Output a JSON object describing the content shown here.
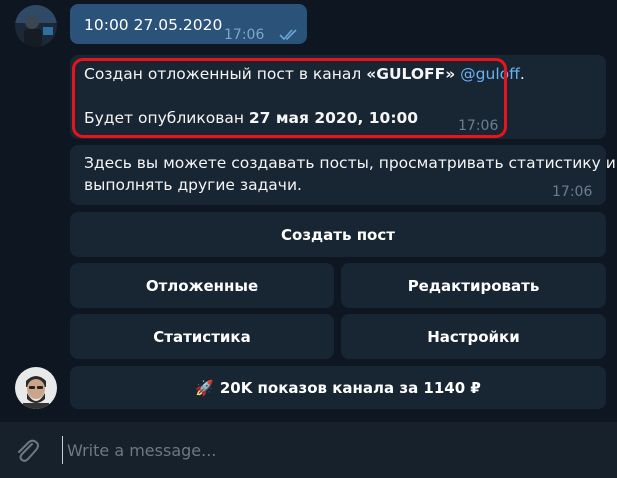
{
  "chat": {
    "outgoing": {
      "text": "10:00 27.05.2020",
      "time": "17:06",
      "status_icon": "double-check-icon"
    },
    "post_message": {
      "prefix": "Создан отложенный пост в канал ",
      "channel": "«GULOFF»",
      "mention": "@guloff",
      "suffix": ".",
      "publish_prefix": "Будет опубликован ",
      "publish_date": "27 мая 2020, 10:00",
      "time": "17:06",
      "highlight_color": "#e8141c"
    },
    "info_message": {
      "line1": "Здесь вы можете создавать посты, просматривать статистику и",
      "line2": "выполнять другие задачи.",
      "time": "17:06"
    }
  },
  "keyboard": {
    "create_post": "Создать пост",
    "scheduled": "Отложенные",
    "edit": "Редактировать",
    "statistics": "Статистика",
    "settings": "Настройки",
    "promo_emoji": "🚀",
    "promo": "20K показов канала за 1140 ₽"
  },
  "composer": {
    "placeholder": "Write a message...",
    "attach_icon": "paperclip-icon"
  },
  "colors": {
    "background": "#0e1621",
    "bubble": "#182533",
    "outgoing_bubble": "#2b5278",
    "link": "#6ab2f2"
  }
}
